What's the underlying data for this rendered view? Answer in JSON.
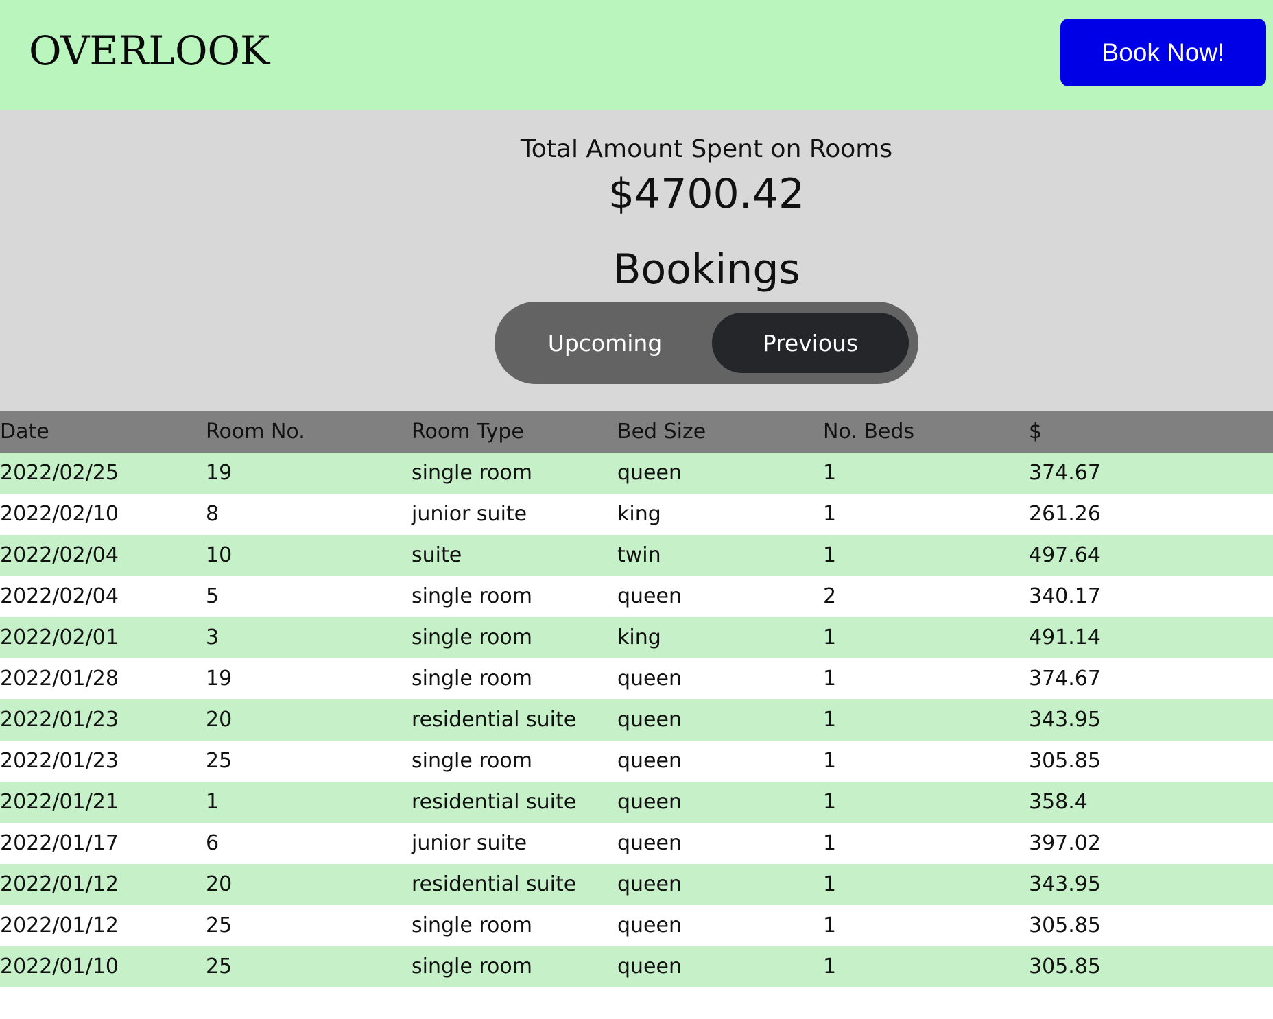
{
  "header": {
    "logo": "OVERLOOK",
    "book_button": "Book Now!"
  },
  "summary": {
    "total_label": "Total Amount Spent on Rooms",
    "total_amount": "$4700.42",
    "bookings_title": "Bookings",
    "toggle": {
      "upcoming": "Upcoming",
      "previous": "Previous",
      "active": "previous"
    }
  },
  "table": {
    "headers": [
      "Date",
      "Room No.",
      "Room Type",
      "Bed Size",
      "No. Beds",
      "$"
    ],
    "rows": [
      [
        "2022/02/25",
        "19",
        "single room",
        "queen",
        "1",
        "374.67"
      ],
      [
        "2022/02/10",
        "8",
        "junior suite",
        "king",
        "1",
        "261.26"
      ],
      [
        "2022/02/04",
        "10",
        "suite",
        "twin",
        "1",
        "497.64"
      ],
      [
        "2022/02/04",
        "5",
        "single room",
        "queen",
        "2",
        "340.17"
      ],
      [
        "2022/02/01",
        "3",
        "single room",
        "king",
        "1",
        "491.14"
      ],
      [
        "2022/01/28",
        "19",
        "single room",
        "queen",
        "1",
        "374.67"
      ],
      [
        "2022/01/23",
        "20",
        "residential suite",
        "queen",
        "1",
        "343.95"
      ],
      [
        "2022/01/23",
        "25",
        "single room",
        "queen",
        "1",
        "305.85"
      ],
      [
        "2022/01/21",
        "1",
        "residential suite",
        "queen",
        "1",
        "358.4"
      ],
      [
        "2022/01/17",
        "6",
        "junior suite",
        "queen",
        "1",
        "397.02"
      ],
      [
        "2022/01/12",
        "20",
        "residential suite",
        "queen",
        "1",
        "343.95"
      ],
      [
        "2022/01/12",
        "25",
        "single room",
        "queen",
        "1",
        "305.85"
      ],
      [
        "2022/01/10",
        "25",
        "single room",
        "queen",
        "1",
        "305.85"
      ]
    ]
  },
  "colors": {
    "header_bg": "#b9f5bd",
    "button_bg": "#0000e6",
    "summary_bg": "#d8d8d8",
    "toggle_bg": "#636363",
    "toggle_active_bg": "#25262a",
    "table_header_bg": "#808080",
    "row_alt_bg": "#c6f1c8"
  }
}
